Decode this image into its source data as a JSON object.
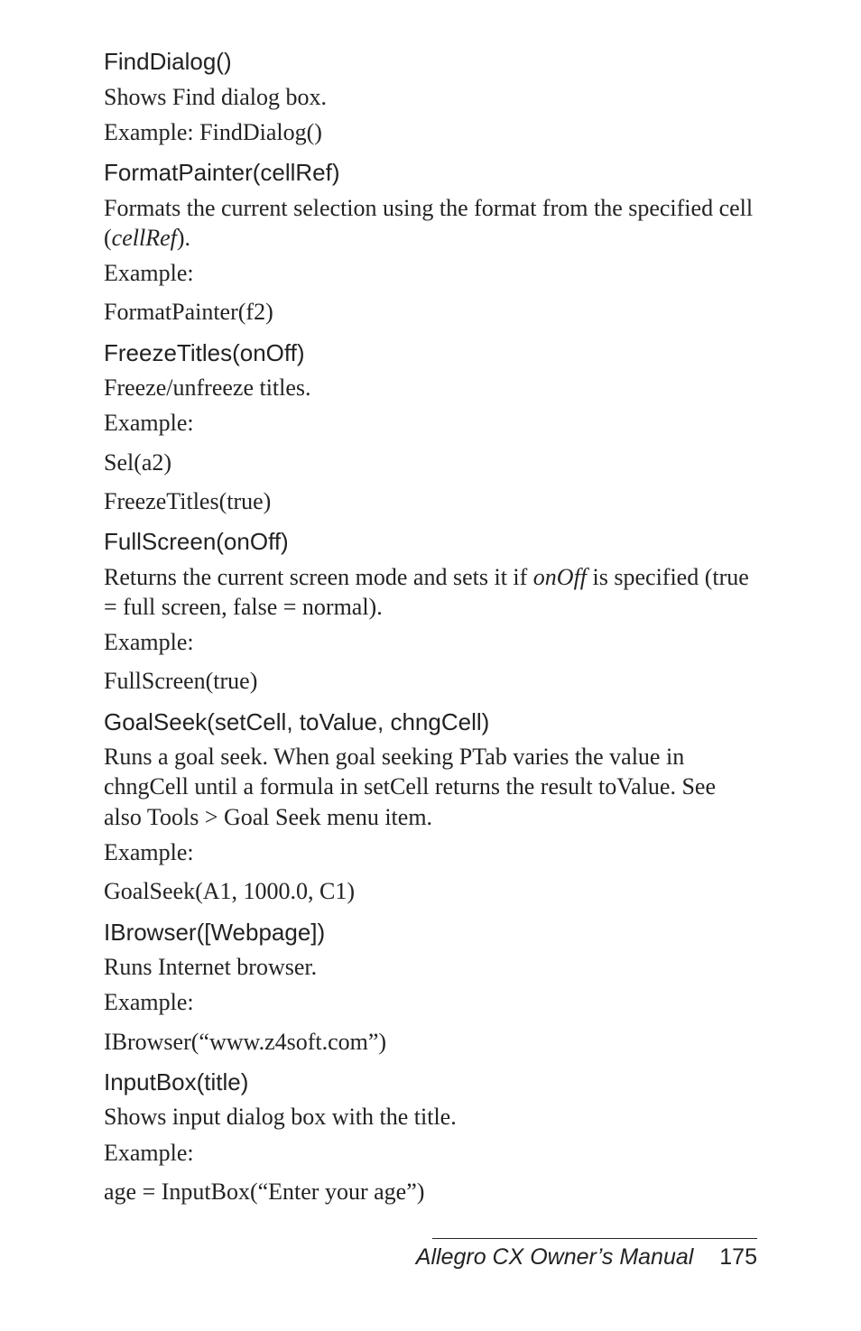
{
  "sections": [
    {
      "heading": "FindDialog()",
      "lines": [
        {
          "text": "Shows Find dialog box.",
          "cls": "tight"
        },
        {
          "text": "Example: FindDialog()",
          "cls": "para"
        }
      ]
    },
    {
      "heading": "FormatPainter(cellRef)",
      "lines": [
        {
          "parts": [
            {
              "text": "Formats the current selection using the format from the specified cell ("
            },
            {
              "text": "cellRef",
              "italic": true
            },
            {
              "text": ")."
            }
          ],
          "cls": "tight"
        },
        {
          "text": "Example:",
          "cls": "para"
        },
        {
          "text": "FormatPainter(f2)",
          "cls": "para"
        }
      ]
    },
    {
      "heading": "FreezeTitles(onOff)",
      "lines": [
        {
          "text": "Freeze/unfreeze titles.",
          "cls": "tight"
        },
        {
          "text": "Example:",
          "cls": "para"
        },
        {
          "text": "Sel(a2)",
          "cls": "para"
        },
        {
          "text": "FreezeTitles(true)",
          "cls": "para"
        }
      ]
    },
    {
      "heading": "FullScreen(onOff)",
      "lines": [
        {
          "parts": [
            {
              "text": "Returns the current screen mode and sets it if "
            },
            {
              "text": "onOff",
              "italic": true
            },
            {
              "text": " is specified (true = full screen, false = normal)."
            }
          ],
          "cls": "tight"
        },
        {
          "text": "Example:",
          "cls": "para"
        },
        {
          "text": "FullScreen(true)",
          "cls": "para"
        }
      ]
    },
    {
      "heading": "GoalSeek(setCell, toValue, chngCell)",
      "lines": [
        {
          "text": "Runs a goal seek. When goal seeking PTab varies the value in chngCell until a formula in setCell returns the result toValue. See also Tools > Goal Seek menu item.",
          "cls": "tight"
        },
        {
          "text": "Example:",
          "cls": "para"
        },
        {
          "text": "GoalSeek(A1, 1000.0, C1)",
          "cls": "para"
        }
      ]
    },
    {
      "heading": "IBrowser([Webpage])",
      "lines": [
        {
          "text": "Runs Internet browser.",
          "cls": "tight"
        },
        {
          "text": "Example:",
          "cls": "para"
        },
        {
          "text": "IBrowser(“www.z4soft.com”)",
          "cls": "para"
        }
      ]
    },
    {
      "heading": "InputBox(title)",
      "lines": [
        {
          "text": "Shows input dialog box with the title.",
          "cls": "tight"
        },
        {
          "text": "Example:",
          "cls": "para"
        },
        {
          "text": "age = InputBox(“Enter your age”)",
          "cls": "para"
        }
      ]
    }
  ],
  "footer": {
    "title": "Allegro CX Owner’s Manual",
    "page": "175"
  }
}
